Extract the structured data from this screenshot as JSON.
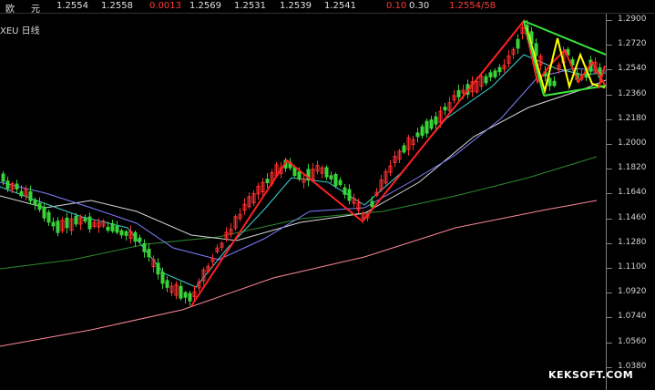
{
  "quote_bar": {
    "name": "欧",
    "unit": "元",
    "last": "1.2554",
    "bid": "1.2558",
    "change": "0.0013",
    "open": "1.2569",
    "low": "1.2531",
    "high": "1.2539",
    "prev": "1.2541",
    "vol1": "0.10",
    "vol2": "0.30",
    "ask": "1.2554/58"
  },
  "symbol_label": "XEU 日线",
  "period_label": "日线",
  "watermark": "KEKSOFT.COM",
  "colors": {
    "background": "#000000",
    "candle_up": "#ff3030",
    "candle_down": "#39d339",
    "zigzag": "#ff2020",
    "triangle": "#39e639",
    "zigzag_yellow": "#ffff00",
    "ma_white": "#d8d8d8",
    "ma_cyan": "#40d0d0",
    "ma_purple": "#8080ff",
    "ma_green": "#2e8b2e",
    "ma_pink": "#ff8a9a"
  },
  "chart_data": {
    "type": "candlestick",
    "y_ticks": [
      "1.2900",
      "1.2720",
      "1.2540",
      "1.2360",
      "1.2180",
      "1.2000",
      "1.1820",
      "1.1640",
      "1.1460",
      "1.1280",
      "1.1100",
      "1.0920",
      "1.0740",
      "1.0560",
      "1.0380"
    ],
    "ylim": [
      1.038,
      1.29
    ]
  }
}
